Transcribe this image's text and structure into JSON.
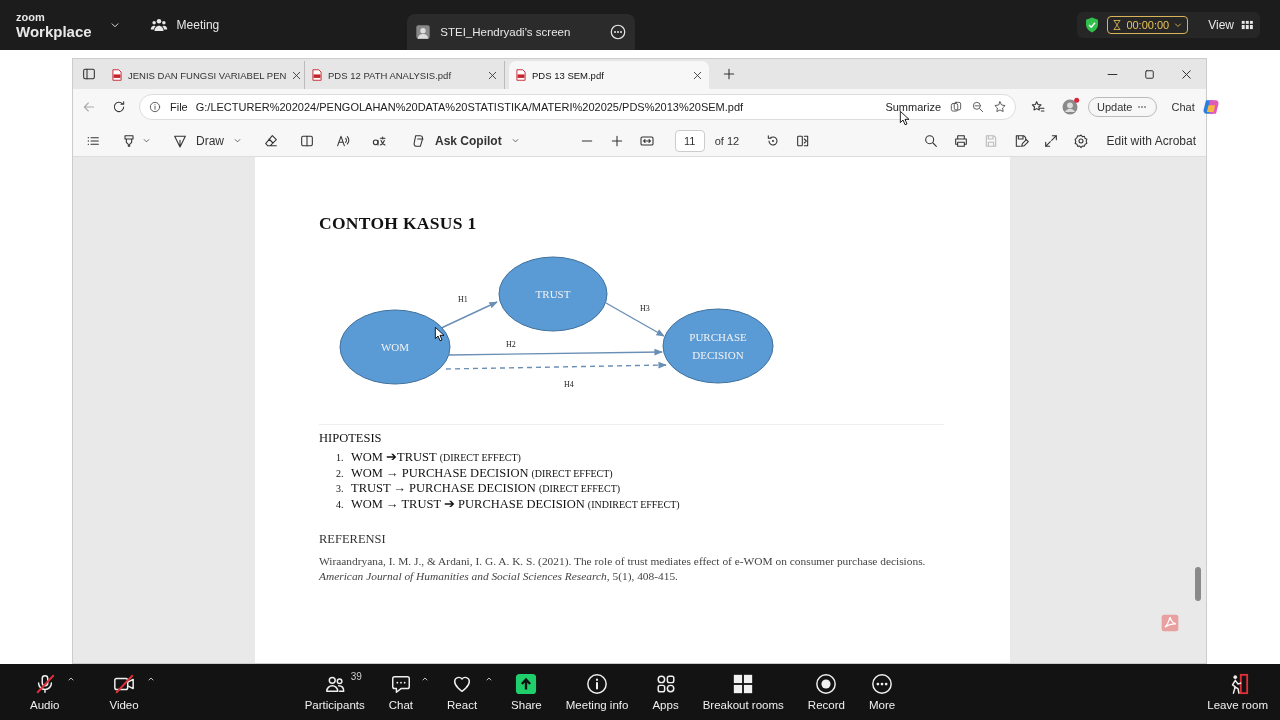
{
  "meeting_bar": {
    "logo_top": "zoom",
    "logo_bottom": "Workplace",
    "meeting_label": "Meeting",
    "share_title": "STEI_Hendryadi's screen",
    "timer": "00:00:00",
    "view_label": "View"
  },
  "browser": {
    "tabs": [
      {
        "title": "JENIS DAN FUNGSI VARIABEL PEN",
        "selected": false
      },
      {
        "title": "PDS 12 PATH ANALYSIS.pdf",
        "selected": false
      },
      {
        "title": "PDS 13 SEM.pdf",
        "selected": true
      }
    ],
    "address": {
      "scheme": "File",
      "url": "G:/LECTURER%202024/PENGOLAHAN%20DATA%20STATISTIKA/MATERI%202025/PDS%2013%20SEM.pdf"
    },
    "summarize": "Summarize",
    "update": "Update",
    "chat": "Chat"
  },
  "pdf_toolbar": {
    "draw": "Draw",
    "ask": "Ask Copilot",
    "page": "11",
    "page_count": "of 12",
    "edit": "Edit with Acrobat"
  },
  "document": {
    "heading": "CONTOH KASUS 1",
    "diagram": {
      "nodes": [
        {
          "label_lines": [
            "WOM"
          ]
        },
        {
          "label_lines": [
            "TRUST"
          ]
        },
        {
          "label_lines": [
            "PURCHASE",
            "DECISION"
          ]
        }
      ],
      "edges": [
        {
          "label": "H1",
          "kind": "solid"
        },
        {
          "label": "H3",
          "kind": "solid"
        },
        {
          "label": "H2",
          "kind": "solid"
        },
        {
          "label": "H4",
          "kind": "dashed"
        }
      ]
    },
    "hypothesis_title": "HIPOTESIS",
    "hypotheses": [
      {
        "number": "1.",
        "text": "WOM ➔TRUST",
        "note": "(DIRECT EFFECT)"
      },
      {
        "number": "2.",
        "text": "WOM → PURCHASE DECISION",
        "note": "(DIRECT EFFECT)"
      },
      {
        "number": "3.",
        "text": "TRUST → PURCHASE DECISION",
        "note": "(DIRECT EFFECT)"
      },
      {
        "number": "4.",
        "text": "WOM → TRUST ➔ PURCHASE DECISION",
        "note": "(INDIRECT EFFECT)"
      }
    ],
    "reference_title": "REFERENSI",
    "reference": "Wiraandryana, I. M. J., & Ardani, I. G. A. K. S. (2021). The role of trust mediates effect of e-WOM on consumer purchase decisions. *American Journal of Humanities and Social Sciences Research*, 5(1), 408-415."
  },
  "left_controls": [
    {
      "kind": "audio",
      "label": "Audio",
      "muted": true,
      "menu": true
    },
    {
      "kind": "video",
      "label": "Video",
      "muted": true,
      "menu": true
    }
  ],
  "center_controls": [
    {
      "kind": "participants",
      "label": "Participants",
      "count": "39"
    },
    {
      "kind": "chat",
      "label": "Chat",
      "menu": true
    },
    {
      "kind": "react",
      "label": "React",
      "menu": true
    },
    {
      "kind": "share",
      "label": "Share"
    },
    {
      "kind": "info",
      "label": "Meeting info"
    },
    {
      "kind": "apps",
      "label": "Apps"
    },
    {
      "kind": "breakout",
      "label": "Breakout rooms"
    },
    {
      "kind": "record",
      "label": "Record"
    },
    {
      "kind": "more",
      "label": "More"
    }
  ],
  "right_controls": [
    {
      "kind": "leave",
      "label": "Leave room"
    }
  ]
}
